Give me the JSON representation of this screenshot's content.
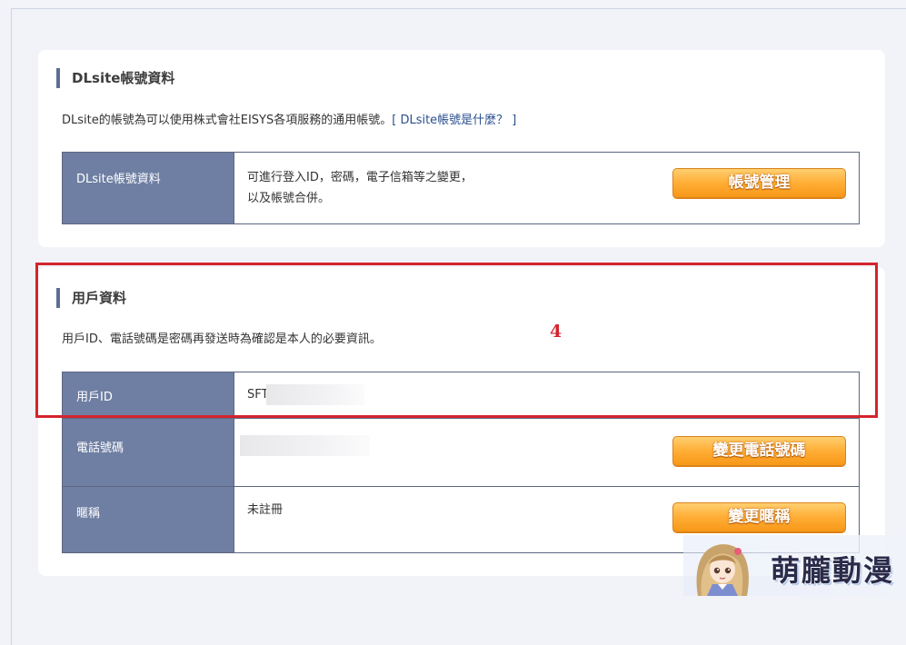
{
  "account_section": {
    "title": "DLsite帳號資料",
    "description": "DLsite的帳號為可以使用株式會社EISYS各項服務的通用帳號。",
    "help_link": "[ DLsite帳號是什麼？ ]",
    "row": {
      "label": "DLsite帳號資料",
      "text_line1": "可進行登入ID，密碼，電子信箱等之變更，",
      "text_line2": "以及帳號合併。",
      "button": "帳號管理"
    }
  },
  "user_section": {
    "title": "用戶資料",
    "description": "用戶ID、電話號碼是密碼再發送時為確認是本人的必要資訊。",
    "rows": [
      {
        "label": "用戶ID",
        "value": "SFT"
      },
      {
        "label": "電話號碼",
        "value": "",
        "button": "變更電話號碼"
      },
      {
        "label": "暱稱",
        "value": "未註冊",
        "button": "變更暱稱"
      }
    ]
  },
  "annotation": {
    "number": "4",
    "color": "#d4242d"
  },
  "watermark": {
    "text": "萌朧動漫"
  },
  "colors": {
    "label_bg": "#6f7fa3",
    "button": "#ffad35",
    "link": "#2a4f8f"
  }
}
